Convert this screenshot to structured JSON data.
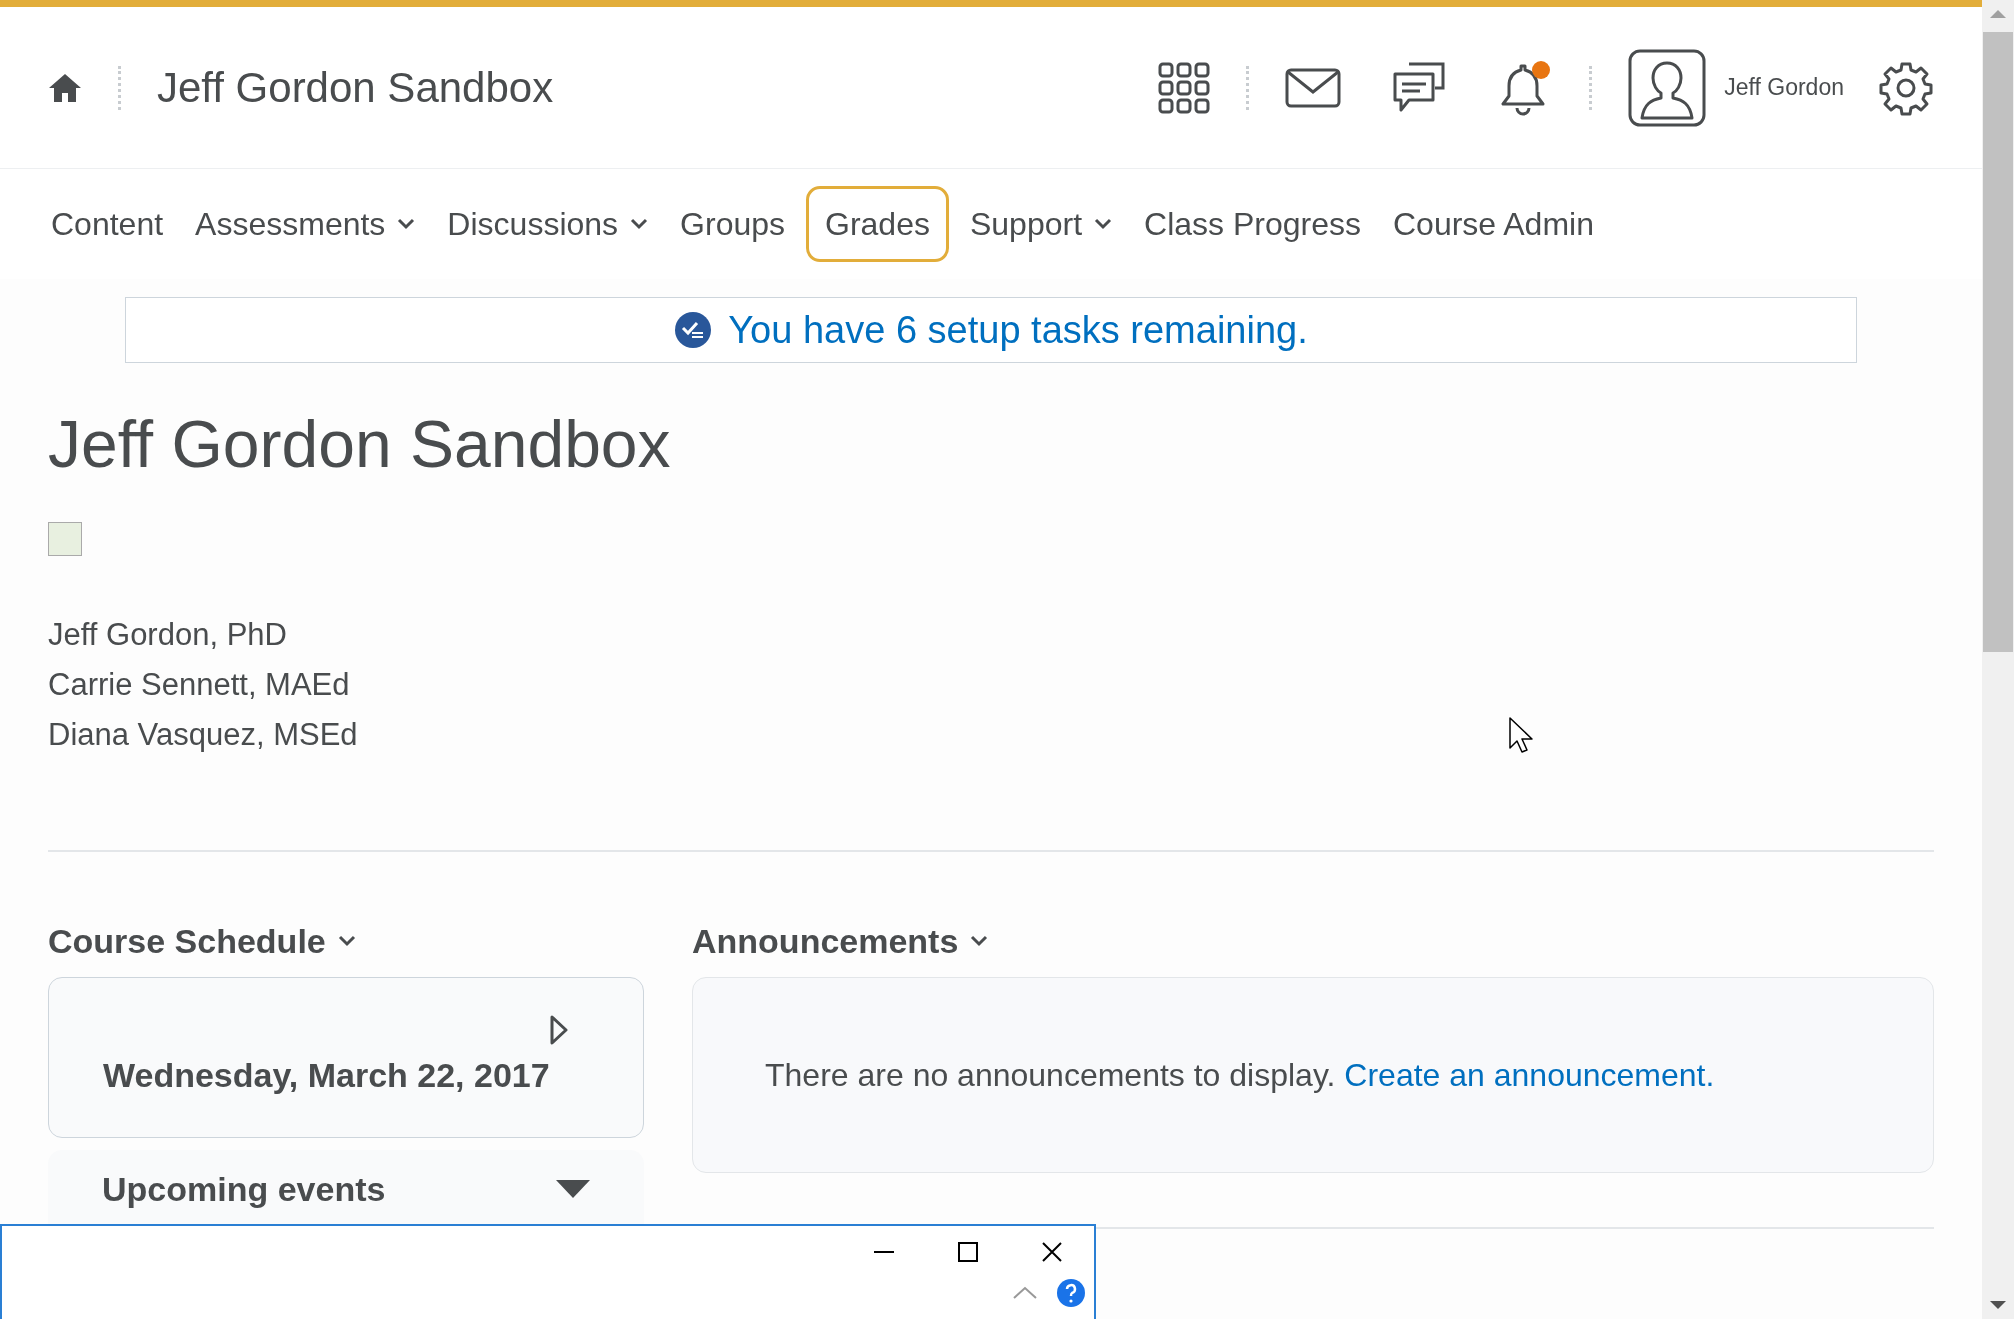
{
  "header": {
    "course_title": "Jeff Gordon Sandbox",
    "user_name": "Jeff Gordon",
    "notification_unread": true
  },
  "nav": [
    {
      "label": "Content",
      "dropdown": false,
      "selected": false
    },
    {
      "label": "Assessments",
      "dropdown": true,
      "selected": false
    },
    {
      "label": "Discussions",
      "dropdown": true,
      "selected": false
    },
    {
      "label": "Groups",
      "dropdown": false,
      "selected": false
    },
    {
      "label": "Grades",
      "dropdown": false,
      "selected": true
    },
    {
      "label": "Support",
      "dropdown": true,
      "selected": false
    },
    {
      "label": "Class Progress",
      "dropdown": false,
      "selected": false
    },
    {
      "label": "Course Admin",
      "dropdown": false,
      "selected": false
    }
  ],
  "setup_banner": "You have 6 setup tasks remaining.",
  "page_title": "Jeff Gordon Sandbox",
  "instructors": [
    "Jeff Gordon, PhD",
    "Carrie Sennett, MAEd",
    "Diana Vasquez, MSEd"
  ],
  "course_schedule": {
    "title": "Course Schedule",
    "date": "Wednesday, March 22, 2017",
    "upcoming_title": "Upcoming events"
  },
  "announcements": {
    "title": "Announcements",
    "empty_text": "There are no announcements to display.",
    "link": "Create an announcement."
  }
}
